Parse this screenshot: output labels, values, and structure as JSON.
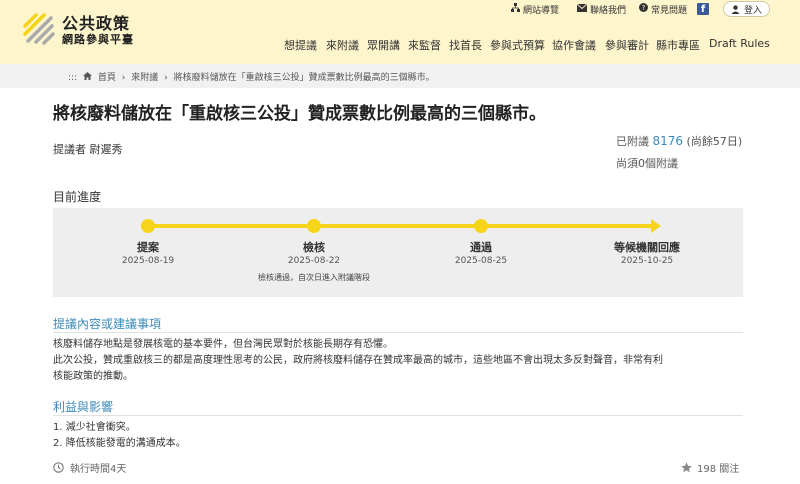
{
  "header": {
    "logo_title": "公共政策",
    "logo_subtitle": "網路參與平臺",
    "util": {
      "sitemap": "網站導覽",
      "contact": "聯絡我們",
      "faq": "常見問題",
      "facebook": "f",
      "login": "登入"
    },
    "nav": [
      "想提議",
      "來附議",
      "眾開講",
      "來監督",
      "找首長",
      "參與式預算",
      "協作會議",
      "參與審計",
      "縣市專區",
      "Draft Rules"
    ]
  },
  "breadcrumb": {
    "home": "首頁",
    "section": "來附議",
    "current": "將核廢料儲放在「重啟核三公投」贊成票數比例最高的三個縣市。"
  },
  "proposal": {
    "title": "將核廢料儲放在「重啟核三公投」贊成票數比例最高的三個縣市。",
    "proposer": "提議者 尉遲秀",
    "signed_prefix": "已附議",
    "signed_count": "8176",
    "signed_suffix": "(尚餘57日)",
    "need_more": "尚須0個附議"
  },
  "progress": {
    "label": "目前進度",
    "stages": [
      {
        "name": "提案",
        "date": "2025-08-19"
      },
      {
        "name": "檢核",
        "date": "2025-08-22",
        "note": "檢核通過，自次日進入附議階段"
      },
      {
        "name": "通過",
        "date": "2025-08-25"
      },
      {
        "name": "等候機關回應",
        "date": "2025-10-25"
      }
    ]
  },
  "content": {
    "heading": "提議內容或建議事項",
    "lines": [
      "核廢料儲存地點是發展核電的基本要件，但台灣民眾對於核能長期存有恐懼。",
      "此次公投，贊成重啟核三的都是高度理性思考的公民，政府將核廢料儲存在贊成率最高的城市，這些地區不會出現太多反對聲音，非常有利",
      "核能政策的推動。"
    ]
  },
  "benefits": {
    "heading": "利益與影響",
    "items": [
      "1. 減少社會衝突。",
      "2. 降低核能發電的溝通成本。"
    ]
  },
  "footer": {
    "duration": "執行時間4天",
    "follow": "198 關注"
  },
  "colors": {
    "header_bg": "#fdf5cc",
    "accent_yellow": "#f5d41a",
    "link_blue": "#3a8bbb"
  }
}
